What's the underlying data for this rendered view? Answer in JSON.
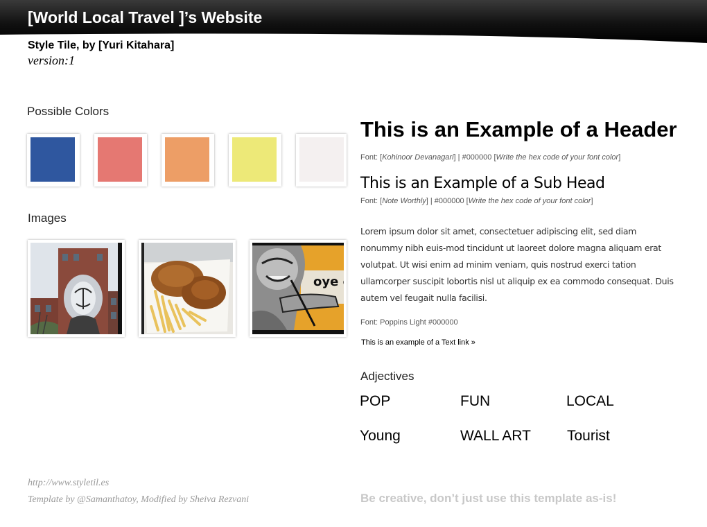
{
  "header": {
    "site_title": "[World Local Travel ]’s Website",
    "byline": "Style Tile, by [Yuri Kitahara]",
    "version": "version:1"
  },
  "colors_section": {
    "title": "Possible Colors",
    "swatches": [
      {
        "name": "blue",
        "hex": "#2f579f"
      },
      {
        "name": "coral",
        "hex": "#e57872"
      },
      {
        "name": "orange",
        "hex": "#ed9e66"
      },
      {
        "name": "yellow",
        "hex": "#ede978"
      },
      {
        "name": "off-white",
        "hex": "#f4f0f0"
      }
    ]
  },
  "images_section": {
    "title": "Images",
    "photos": [
      {
        "subject": "mural on brick building"
      },
      {
        "subject": "fried chicken and chips"
      },
      {
        "subject": "street art of a musician"
      }
    ]
  },
  "typography": {
    "header_sample": "This is an Example of a Header",
    "header_note": {
      "prefix": "Font: [",
      "font": "Kohinoor Devanagari",
      "middle": "]  |  #000000 [",
      "hex_hint": "Write the hex code of your font color",
      "suffix": "]"
    },
    "subhead_sample": "This is an Example of a Sub Head",
    "subhead_note": {
      "prefix": "Font: [",
      "font": "Note Worthly",
      "middle": "]  |  #000000 [",
      "hex_hint": "Write the hex code of your font color",
      "suffix": "]"
    },
    "body_text": "Lorem ipsum dolor sit amet, consectetuer adipiscing elit, sed diam nonummy nibh euis-mod tincidunt ut laoreet dolore magna aliquam erat volutpat. Ut wisi enim ad minim veniam, quis nostrud exerci tation ullamcorper suscipit lobortis nisl ut aliquip ex ea commodo consequat. Duis autem vel feugait nulla facilisi.",
    "body_note": "Font: Poppins Light #000000",
    "text_link": "This is an example of a Text link »"
  },
  "adjectives": {
    "title": "Adjectives",
    "items": [
      "POP",
      "FUN",
      "LOCAL",
      "Young",
      "WALL ART",
      "Tourist"
    ]
  },
  "footer": {
    "url": "http://www.styletil.es",
    "credit": "Template by @Samanthatoy, Modified by Sheiva Rezvani",
    "note": "Be creative, don’t just use this template as-is!"
  }
}
